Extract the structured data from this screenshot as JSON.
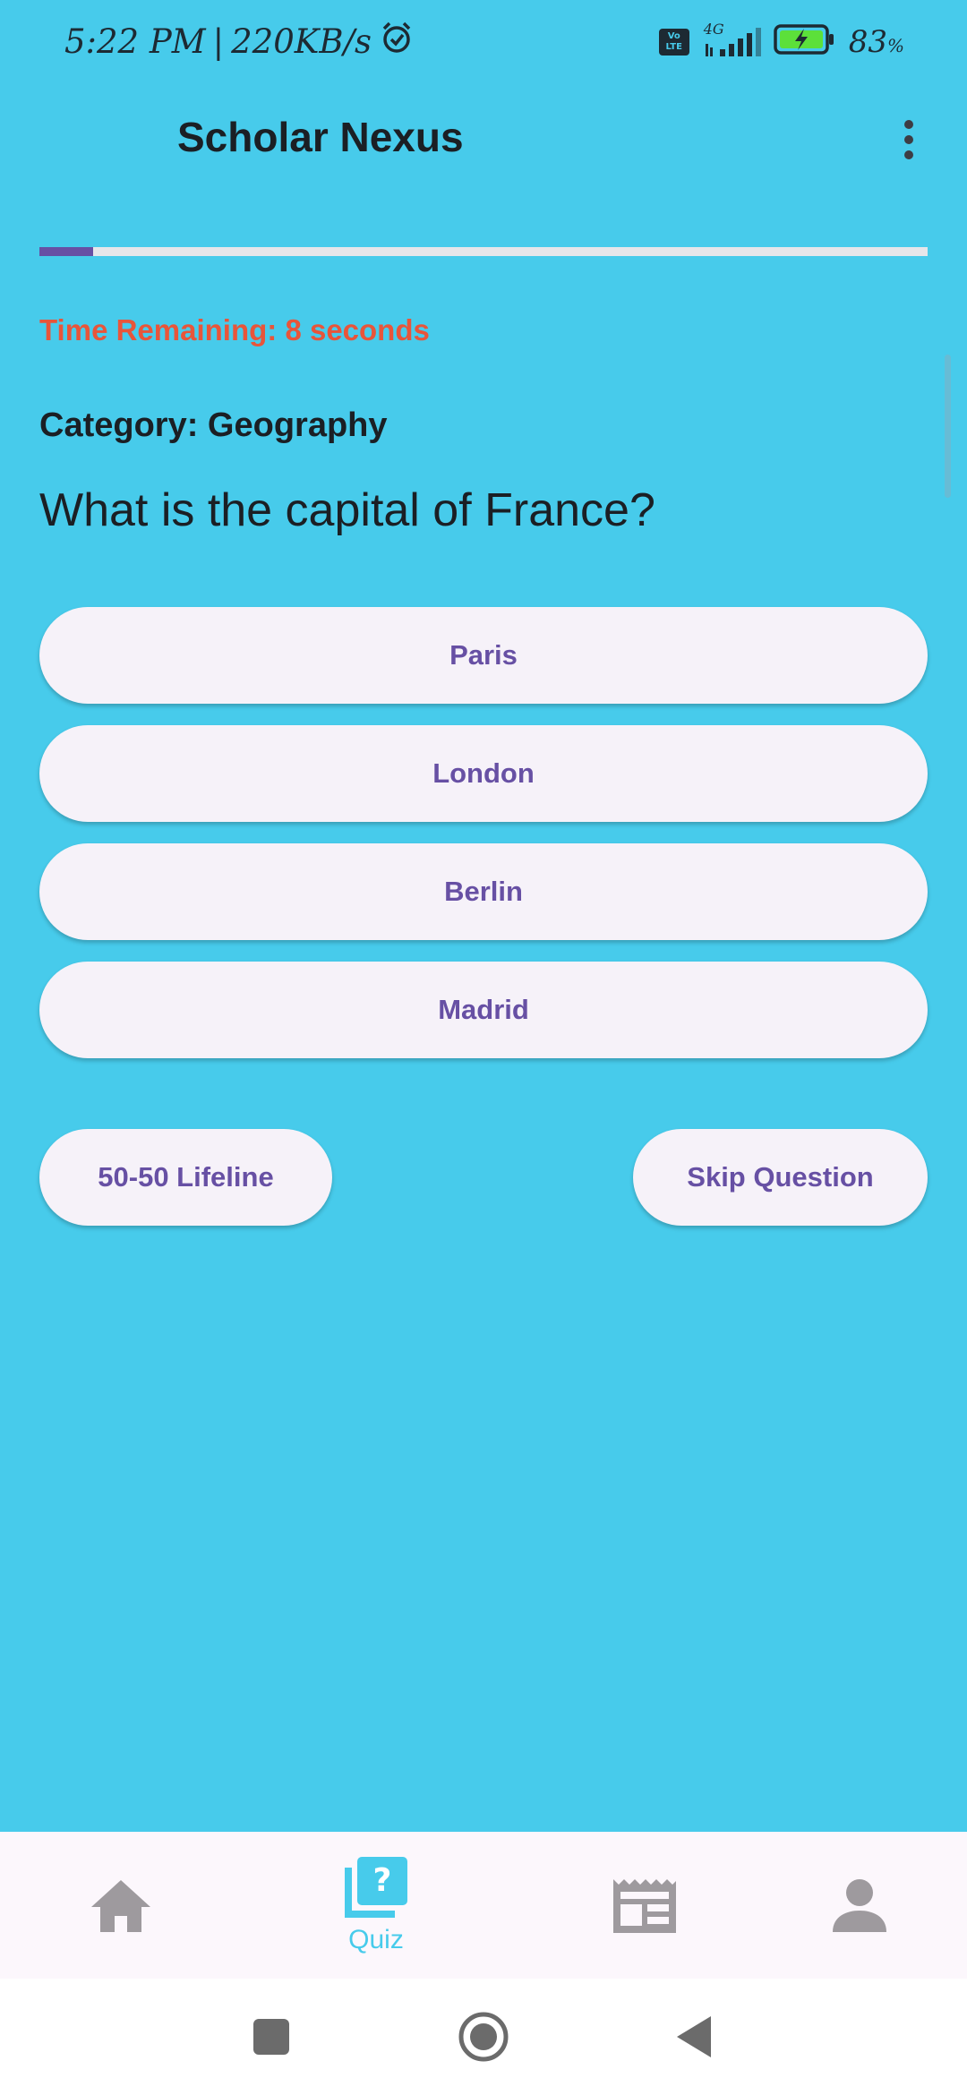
{
  "status_bar": {
    "time": "5:22 PM",
    "separator": "|",
    "speed": "220KB/s",
    "network": "4G",
    "volte_line1": "Vo",
    "volte_line2": "LTE",
    "battery_value": "83",
    "battery_unit": "%"
  },
  "app_bar": {
    "title": "Scholar Nexus"
  },
  "quiz": {
    "progress_fraction": 0.06,
    "timer_text": "Time Remaining: 8 seconds",
    "category_text": "Category: Geography",
    "question": "What is the capital of France?",
    "answers": [
      "Paris",
      "London",
      "Berlin",
      "Madrid"
    ],
    "lifeline_label": "50-50 Lifeline",
    "skip_label": "Skip Question"
  },
  "bottom_nav": {
    "items": [
      {
        "icon": "home-icon",
        "label": ""
      },
      {
        "icon": "quiz-icon",
        "label": "Quiz"
      },
      {
        "icon": "news-icon",
        "label": ""
      },
      {
        "icon": "person-icon",
        "label": ""
      }
    ],
    "active_color": "#47CBEB",
    "inactive_color": "#9E9A9E"
  },
  "colors": {
    "background": "#47CBEB",
    "accent": "#6750A4",
    "timer": "#E8553A",
    "button_bg": "#F6F2F9"
  }
}
